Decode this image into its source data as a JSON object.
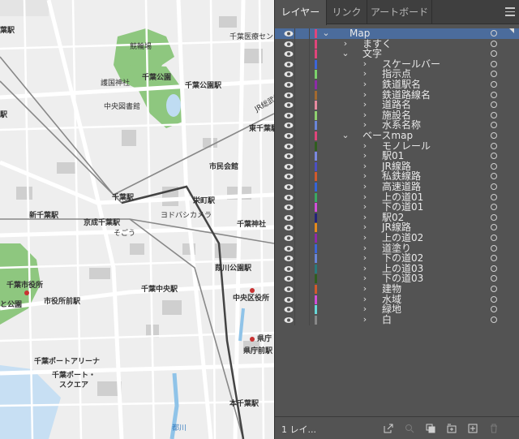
{
  "map": {
    "labels": [
      {
        "id": "kyoutei",
        "text": "競輪場"
      },
      {
        "id": "chiba_park",
        "text": "千葉公園"
      },
      {
        "id": "chiba_park_sta",
        "text": "千葉公園駅"
      },
      {
        "id": "goshin",
        "text": "護国神社"
      },
      {
        "id": "library",
        "text": "中央図書館"
      },
      {
        "id": "hospital",
        "text": "千葉医療センタ"
      },
      {
        "id": "eki_top",
        "text": "葉駅"
      },
      {
        "id": "eki_left",
        "text": "駅"
      },
      {
        "id": "jr_line",
        "text": "JR総武線"
      },
      {
        "id": "higashi_chiba",
        "text": "東千葉駅"
      },
      {
        "id": "shimin",
        "text": "市民会館"
      },
      {
        "id": "chiba_sta",
        "text": "千葉駅"
      },
      {
        "id": "sakaecho",
        "text": "栄町駅"
      },
      {
        "id": "shin_chiba",
        "text": "新千葉駅"
      },
      {
        "id": "keisei_chiba",
        "text": "京成千葉駅"
      },
      {
        "id": "yodobashi",
        "text": "ヨドバシカメラ"
      },
      {
        "id": "sogo",
        "text": "そごう"
      },
      {
        "id": "chiba_jinja",
        "text": "千葉神社"
      },
      {
        "id": "yoshikawa",
        "text": "葭川公園駅"
      },
      {
        "id": "city_office",
        "text": "千葉市役所"
      },
      {
        "id": "koen_left",
        "text": "と公園"
      },
      {
        "id": "shiyakusho_mae",
        "text": "市役所前駅"
      },
      {
        "id": "chiba_chuo",
        "text": "千葉中央駅"
      },
      {
        "id": "chuo_ku",
        "text": "中央区役所"
      },
      {
        "id": "kencho",
        "text": "県庁"
      },
      {
        "id": "kencho_mae",
        "text": "県庁前駅"
      },
      {
        "id": "port_arena",
        "text": "千葉ポートアリーナ"
      },
      {
        "id": "port_square1",
        "text": "千葉ポート・"
      },
      {
        "id": "port_square2",
        "text": "スクエア"
      },
      {
        "id": "hon_chiba",
        "text": "本千葉駅"
      },
      {
        "id": "miyako",
        "text": "都川"
      }
    ]
  },
  "panel": {
    "tabs": [
      {
        "label": "レイヤー",
        "active": true
      },
      {
        "label": "リンク",
        "active": false
      },
      {
        "label": "アートボード",
        "active": false
      }
    ],
    "layers": [
      {
        "name": "Map",
        "depth": 0,
        "arrow": "⌄",
        "color": "#e0457b",
        "selected": true
      },
      {
        "name": "ますく",
        "depth": 1,
        "arrow": "›",
        "color": "#e0457b"
      },
      {
        "name": "文字",
        "depth": 1,
        "arrow": "⌄",
        "color": "#e0457b"
      },
      {
        "name": "スケールバー",
        "depth": 2,
        "arrow": "›",
        "color": "#3c66d8"
      },
      {
        "name": "指示点",
        "depth": 2,
        "arrow": "›",
        "color": "#7bd36b"
      },
      {
        "name": "鉄道駅名",
        "depth": 2,
        "arrow": "›",
        "color": "#8e2aa8"
      },
      {
        "name": "鉄道路線名",
        "depth": 2,
        "arrow": "›",
        "color": "#a36a2f"
      },
      {
        "name": "道路名",
        "depth": 2,
        "arrow": "›",
        "color": "#e78aa0"
      },
      {
        "name": "施設名",
        "depth": 2,
        "arrow": "›",
        "color": "#8fd16f"
      },
      {
        "name": "水系名称",
        "depth": 2,
        "arrow": "›",
        "color": "#6a86d8"
      },
      {
        "name": "ベースmap",
        "depth": 1,
        "arrow": "⌄",
        "color": "#e0457b"
      },
      {
        "name": "モノレール",
        "depth": 2,
        "arrow": "›",
        "color": "#2f5e1e"
      },
      {
        "name": "駅01",
        "depth": 2,
        "arrow": "›",
        "color": "#7a89e0"
      },
      {
        "name": "JR線路",
        "depth": 2,
        "arrow": "›",
        "color": "#4b4fc2"
      },
      {
        "name": "私鉄線路",
        "depth": 2,
        "arrow": "›",
        "color": "#d25a2c"
      },
      {
        "name": "高速道路",
        "depth": 2,
        "arrow": "›",
        "color": "#3464d8"
      },
      {
        "name": "上の道01",
        "depth": 2,
        "arrow": "›",
        "color": "#3aa860"
      },
      {
        "name": "下の道01",
        "depth": 2,
        "arrow": "›",
        "color": "#d04fd8"
      },
      {
        "name": "駅02",
        "depth": 2,
        "arrow": "›",
        "color": "#23237a"
      },
      {
        "name": "JR線路",
        "depth": 2,
        "arrow": "›",
        "color": "#e58a1c"
      },
      {
        "name": "上の道02",
        "depth": 2,
        "arrow": "›",
        "color": "#8e2aa8"
      },
      {
        "name": "道塗り",
        "depth": 2,
        "arrow": "›",
        "color": "#3c66d8"
      },
      {
        "name": "下の道02",
        "depth": 2,
        "arrow": "›",
        "color": "#6a86d8"
      },
      {
        "name": "上の道03",
        "depth": 2,
        "arrow": "›",
        "color": "#2a7a7a"
      },
      {
        "name": "下の道03",
        "depth": 2,
        "arrow": "›",
        "color": "#2f5e1e"
      },
      {
        "name": "建物",
        "depth": 2,
        "arrow": "›",
        "color": "#d25a2c"
      },
      {
        "name": "水域",
        "depth": 2,
        "arrow": "›",
        "color": "#d04fd8"
      },
      {
        "name": "緑地",
        "depth": 2,
        "arrow": "›",
        "color": "#68d8d8"
      },
      {
        "name": "白",
        "depth": 2,
        "arrow": "›",
        "color": "#888888"
      }
    ],
    "footer": {
      "count": "1 レイ...",
      "icons": [
        "export-icon",
        "search-icon",
        "clipping-mask-icon",
        "new-sublayer-icon",
        "new-layer-icon",
        "delete-icon"
      ]
    }
  }
}
